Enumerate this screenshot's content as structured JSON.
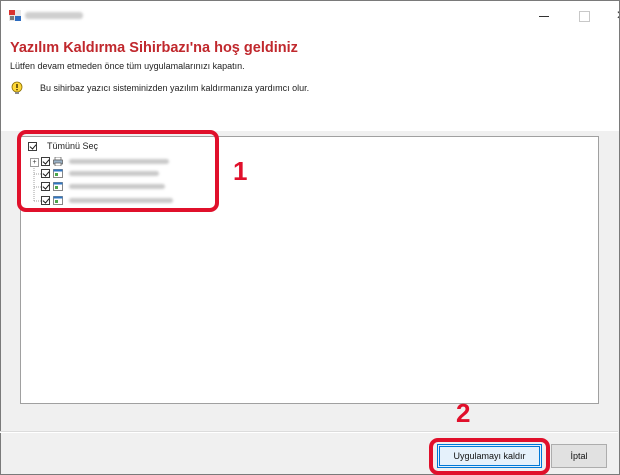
{
  "window": {
    "controls": {
      "minimize": "–",
      "maximize": "□",
      "close": "×"
    }
  },
  "header": {
    "title": "Yazılım Kaldırma Sihirbazı'na hoş geldiniz",
    "instruction": "Lütfen devam etmeden önce tüm uygulamalarınızı kapatın.",
    "info_text": "Bu sihirbaz yazıcı sisteminizden yazılım kaldırmanıza yardımcı olur."
  },
  "tree": {
    "select_all_label": "Tümünü Seç",
    "expander_symbol": "+",
    "items": [
      {
        "checked": true,
        "icon": "printer-icon"
      },
      {
        "checked": true,
        "icon": "application-icon"
      },
      {
        "checked": true,
        "icon": "application-icon"
      },
      {
        "checked": true,
        "icon": "application-icon"
      }
    ]
  },
  "callouts": {
    "step1": "1",
    "step2": "2"
  },
  "buttons": {
    "uninstall_label": "Uygulamayı kaldır",
    "cancel_label": "İptal"
  },
  "colors": {
    "title_red": "#c0282d",
    "callout_red": "#e0102b",
    "focus_blue": "#0078d7"
  }
}
